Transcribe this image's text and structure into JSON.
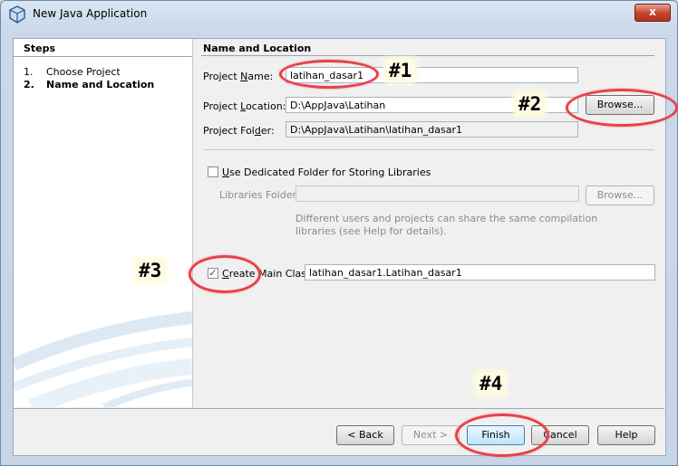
{
  "window": {
    "title": "New Java Application",
    "close_label": "x"
  },
  "steps": {
    "title": "Steps",
    "items": [
      {
        "num": "1.",
        "label": "Choose Project"
      },
      {
        "num": "2.",
        "label": "Name and Location"
      }
    ]
  },
  "section_title": "Name and Location",
  "project_name": {
    "label_pre": "Project ",
    "label_key": "N",
    "label_post": "ame:",
    "value": "latihan_dasar1"
  },
  "project_location": {
    "label_pre": "Project ",
    "label_key": "L",
    "label_post": "ocation:",
    "value": "D:\\AppJava\\Latihan",
    "browse_label": "Browse..."
  },
  "project_folder": {
    "label_pre": "Project Fol",
    "label_key": "d",
    "label_post": "er:",
    "value": "D:\\AppJava\\Latihan\\latihan_dasar1"
  },
  "dedicated": {
    "label_key": "U",
    "label_post": "se Dedicated Folder for Storing Libraries",
    "checked": false
  },
  "libraries": {
    "label": "Libraries Folder:",
    "value": "",
    "browse_label": "Browse...",
    "help_line1": "Different users and projects can share the same compilation",
    "help_line2": "libraries (see Help for details)."
  },
  "main_class": {
    "label_key": "C",
    "label_post": "reate Main Class",
    "checked": true,
    "check_glyph": "✓",
    "value": "latihan_dasar1.Latihan_dasar1"
  },
  "buttons": {
    "back": "< Back",
    "next": "Next >",
    "finish": "Finish",
    "cancel": "Cancel",
    "help": "Help"
  },
  "annotations": {
    "tag1": "#1",
    "tag2": "#2",
    "tag3": "#3",
    "tag4": "#4",
    "color": "#e8414a"
  }
}
